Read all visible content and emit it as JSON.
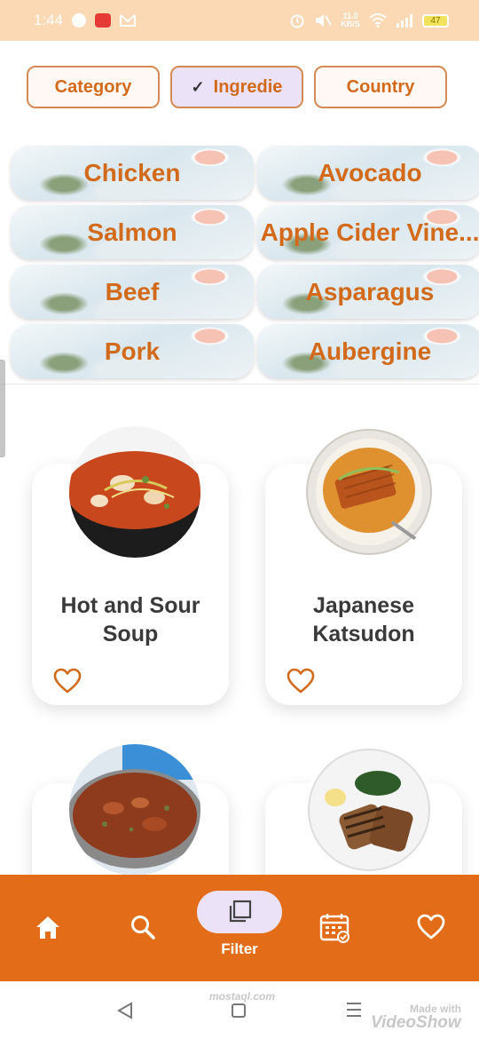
{
  "status_bar": {
    "time": "1:44",
    "network_speed": "11.0 KB/S",
    "battery": "47"
  },
  "filters": [
    {
      "label": "Category",
      "selected": false
    },
    {
      "label": "Ingredie",
      "selected": true
    },
    {
      "label": "Country",
      "selected": false
    }
  ],
  "ingredients": [
    "Chicken",
    "Avocado",
    "Salmon",
    "Apple Cider Vine...",
    "Beef",
    "Asparagus",
    "Pork",
    "Aubergine"
  ],
  "meals": [
    {
      "title": "Hot and Sour Soup"
    },
    {
      "title": "Japanese Katsudon"
    },
    {
      "title": ""
    },
    {
      "title": ""
    }
  ],
  "bottom_nav": {
    "items": [
      {
        "icon": "home-icon",
        "label": ""
      },
      {
        "icon": "search-icon",
        "label": ""
      },
      {
        "icon": "filter-icon",
        "label": "Filter"
      },
      {
        "icon": "calendar-icon",
        "label": ""
      },
      {
        "icon": "heart-icon",
        "label": ""
      }
    ]
  },
  "watermarks": {
    "made_with": "Made with",
    "brand": "VideoShow",
    "site": "mostaql.com"
  },
  "colors": {
    "accent": "#e26c17",
    "chip_text": "#d26a1a",
    "selected_chip": "#ece2f8",
    "status_bar": "#fbd9b4"
  }
}
